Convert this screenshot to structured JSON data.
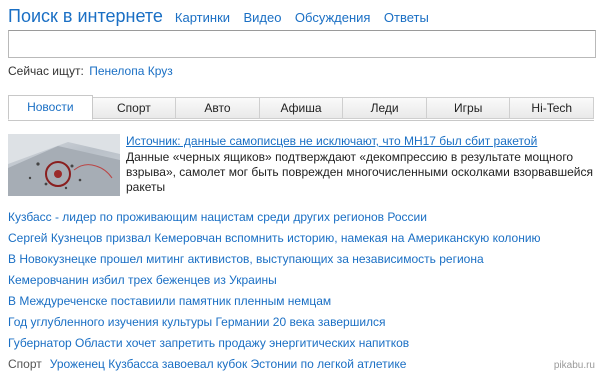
{
  "header": {
    "title": "Поиск в интернете",
    "nav": [
      "Картинки",
      "Видео",
      "Обсуждения",
      "Ответы"
    ]
  },
  "search": {
    "value": "",
    "placeholder": ""
  },
  "now_searching": {
    "label": "Сейчас ищут:",
    "query": "Пенелопа Круз"
  },
  "tabs": [
    "Новости",
    "Спорт",
    "Авто",
    "Афиша",
    "Леди",
    "Игры",
    "Hi-Tech"
  ],
  "active_tab": "Новости",
  "featured": {
    "title": "Источник: данные самописцев не исключают, что MH17 был сбит ракетой",
    "description": "Данные «черных ящиков» подтверждают «декомпрессию в результате мощного взрыва», самолет мог быть поврежден многочисленными осколками взорвавшейся ракеты"
  },
  "news": [
    {
      "title": "Кузбасс - лидер по проживающим нацистам среди других регионов России"
    },
    {
      "title": "Сергей Кузнецов призвал Кемеровчан вспомнить историю, намекая на Американскую колонию"
    },
    {
      "title": "В Новокузнецке прошел митинг активистов, выступающих за независимость региона"
    },
    {
      "title": "Кемеровчанин избил трех беженцев из Украины"
    },
    {
      "title": "В Междуреченске поставиили памятник пленным немцам"
    },
    {
      "title": "Год углубленного изучения культуры Германии 20 века завершился"
    },
    {
      "title": "Губернатор Области хочет запретить продажу энергитических напитков"
    },
    {
      "category": "Спорт",
      "title": "Уроженец Кузбасса завоевал кубок Эстонии по легкой атлетике"
    }
  ],
  "watermark": "pikabu.ru",
  "colors": {
    "link": "#1a6fc4",
    "text": "#222222",
    "tab_border": "#cfcfcf"
  }
}
